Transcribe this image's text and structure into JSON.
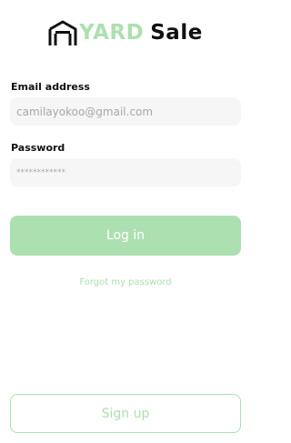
{
  "logo": {
    "icon": "garage-icon",
    "brand_part_1": "YARD",
    "brand_part_2": "Sale"
  },
  "form": {
    "email_label": "Email address",
    "email_value": "camilayokoo@gmail.com",
    "password_label": "Password",
    "password_value": "************"
  },
  "actions": {
    "login_label": "Log in",
    "forgot_label": "Forgot my password",
    "signup_label": "Sign up"
  },
  "colors": {
    "accent": "#ade0b0",
    "text": "#111111",
    "field_bg": "#f6f6f6",
    "placeholder": "#a7a7a7"
  }
}
